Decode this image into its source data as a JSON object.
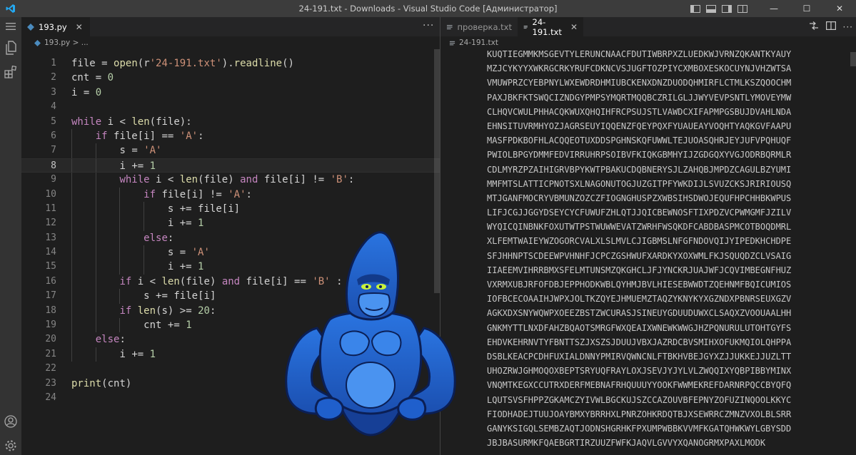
{
  "window": {
    "title": "24-191.txt - Downloads - Visual Studio Code [Администратор]"
  },
  "colors": {
    "keyword": "#c586c0",
    "function": "#dcdcaa",
    "string": "#ce9178",
    "number": "#b5cea8",
    "accent": "#23a9f2",
    "mascot_blue": "#1f5fcc"
  },
  "left_editor": {
    "tabs": [
      {
        "label": "193.py",
        "icon": "python-file-icon",
        "active": true
      }
    ],
    "breadcrumb": "193.py > ...",
    "current_line": 8,
    "lines": [
      {
        "n": "1",
        "code": "file = open(r'24-191.txt').readline()"
      },
      {
        "n": "2",
        "code": "cnt = 0"
      },
      {
        "n": "3",
        "code": "i = 0"
      },
      {
        "n": "4",
        "code": ""
      },
      {
        "n": "5",
        "code": "while i < len(file):"
      },
      {
        "n": "6",
        "code": "    if file[i] == 'A':"
      },
      {
        "n": "7",
        "code": "        s = 'A'"
      },
      {
        "n": "8",
        "code": "        i += 1"
      },
      {
        "n": "9",
        "code": "        while i < len(file) and file[i] != 'B':"
      },
      {
        "n": "10",
        "code": "            if file[i] != 'A':"
      },
      {
        "n": "11",
        "code": "                s += file[i]"
      },
      {
        "n": "12",
        "code": "                i += 1"
      },
      {
        "n": "13",
        "code": "            else:"
      },
      {
        "n": "14",
        "code": "                s = 'A'"
      },
      {
        "n": "15",
        "code": "                i += 1"
      },
      {
        "n": "16",
        "code": "        if i < len(file) and file[i] == 'B' :"
      },
      {
        "n": "17",
        "code": "            s += file[i]"
      },
      {
        "n": "18",
        "code": "        if len(s) >= 20:"
      },
      {
        "n": "19",
        "code": "            cnt += 1"
      },
      {
        "n": "20",
        "code": "    else:"
      },
      {
        "n": "21",
        "code": "        i += 1"
      },
      {
        "n": "22",
        "code": ""
      },
      {
        "n": "23",
        "code": "print(cnt)"
      },
      {
        "n": "24",
        "code": ""
      }
    ]
  },
  "right_editor": {
    "tabs": [
      {
        "label": "проверка.txt",
        "icon": "text-file-icon",
        "active": false
      },
      {
        "label": "24-191.txt",
        "icon": "text-file-icon",
        "active": true
      }
    ],
    "breadcrumb": "24-191.txt",
    "lines": [
      "KUQTIEGMMKMSGEVTYLERUNCNAACFDUTIWBRPXZLUEDKWJVRNZQKANTKYAUY",
      "MZJCYKYYXWKRGCRKYRUFCDKNCVSJUGFTOZPIYCXMBOXESKOCUYNJVHZWTSA",
      "VMUWPRZCYEBPNYLWXEWDRDHMIUBCKENXDNZDUODQHMIRFLCTMLKSZQOOCHM",
      "PAXJBKFKTSWQCIZNDGYPMPSYMQRTMQQBCZRILGLJJWYVEVPSNTLYMOVEYMW",
      "CLHQVCWULPHHACQKWUXQHQIHFRCPSUJSTLVAWDCXIFAPMPGSBUJDVAHLNDA",
      "EHNSITUVRMHYOZJAGRSEUYIQQENZFQEYPQXFYUAUEAYVOQHTYAQKGVFAAPU",
      "MASFPDKBOFHLACQQEOTUXDDSPGHNSKQFUWWLTEJUOASQHRJEYJUFVPQHUQF",
      "PWIOLBPGYDMMFEDVIRRUHRPSOIBVFKIQKGBMHYIJZGDGQXYVGJODRBQRMLR",
      "CDLMYRZPZAIHIGRVBPYKWTPBAKUCDQBNERYSJLZAHQBJMPDZCAGULBZYUMI",
      "MMFMTSLATTICPNOTSXLNAGONUTOGJUZGITPFYWKDIJLSVUZCKSJRIRIOUSQ",
      "MTJGANFMOCRYVBMUNZOZCZFIOGNGHUSPZXWBSIHSDWOJEQUFHPCHHBKWPUS",
      "LIFJCGJJGGYDSEYCYCFUWUFZHLQTJJQICBEWNOSFTIXPDZVCPWMGMFJZILV",
      "WYQICQINBNKFOXUTWTPSTWUWWEVATZWRHFWSQKDFCABDBASPMCOTBOQDMRL",
      "XLFEMTWAIEYWZOGORCVALXLSLMVLCJIGBMSLNFGFNDOVQIJYIPEDKHCHDPE",
      "SFJHHNPTSCDEEWPVHNHFJCPCZGSHWUFXARDKYXOXWMLFKJSQUQDZCLVSAIG",
      "IIAEEMVIHRRBMXSFELMTUNSMZQKGHCLJFJYNCKRJUAJWFJCQVIMBEGNFHUZ",
      "VXRMXUBJRFOFDBJEPPHODKWBLQYHMJBVLHIESEBWWDTZQEHNMFBQICUMIOS",
      "IOFBCECOAAIHJWPXJOLTKZQYEJHMUEMZTAQZYKNYKYXGZNDXPBNRSEUXGZV",
      "AGKXDXSNYWQWPXOEEZBSTZWCURASJSINEUYGDUUDUWXCLSAQXZVOOUAALHH",
      "GNKMYTTLNXDFAHZBQAOTSMRGFWXQEAIXWNEWKWWGJHZPQNURULUTOHTGYFS",
      "EHDVKEHRNVTYFBNTTSZJXSZSJDUUJVBXJAZRDCBVSMIHXOFUKMQIOLQHPPA",
      "DSBLKEACPCDHFUXIALDNNYPMIRVQWNCNLFTBKHVBEJGYXZJJUKKEJJUZLTT",
      "UHOZRWJGHMOQOXBEPTSRYUQFRAYLOXJSEVJYJYLVLZWQQIXYQBPIBBYMINX",
      "VNQMTKEGXCCUTRXDERFMEBNAFRHQUUUYYOOKFWWMEKREFDARNRPQCCBYQFQ",
      "LQUTSVSFHPPZGKAMCZYIVWLBGCKUJSZCCAZOUVBFEPNYZOFUZINQOOLKKYC",
      "FIODHADEJTUUJOAYBMXYBRRHXLPNRZOHKRDQTBJXSEWRRCZMNZVXOLBLSRR",
      "GANYKSIGQLSEMBZAQTJODNSHGRHKFPXUMPWBBKVVMFKGATQHWKWYLGBYSDD",
      "JBJBASURMKFQAEBGRTIRZUUZFWFKJAQVLGVVYXQANOGRMXPAXLMODK"
    ]
  }
}
